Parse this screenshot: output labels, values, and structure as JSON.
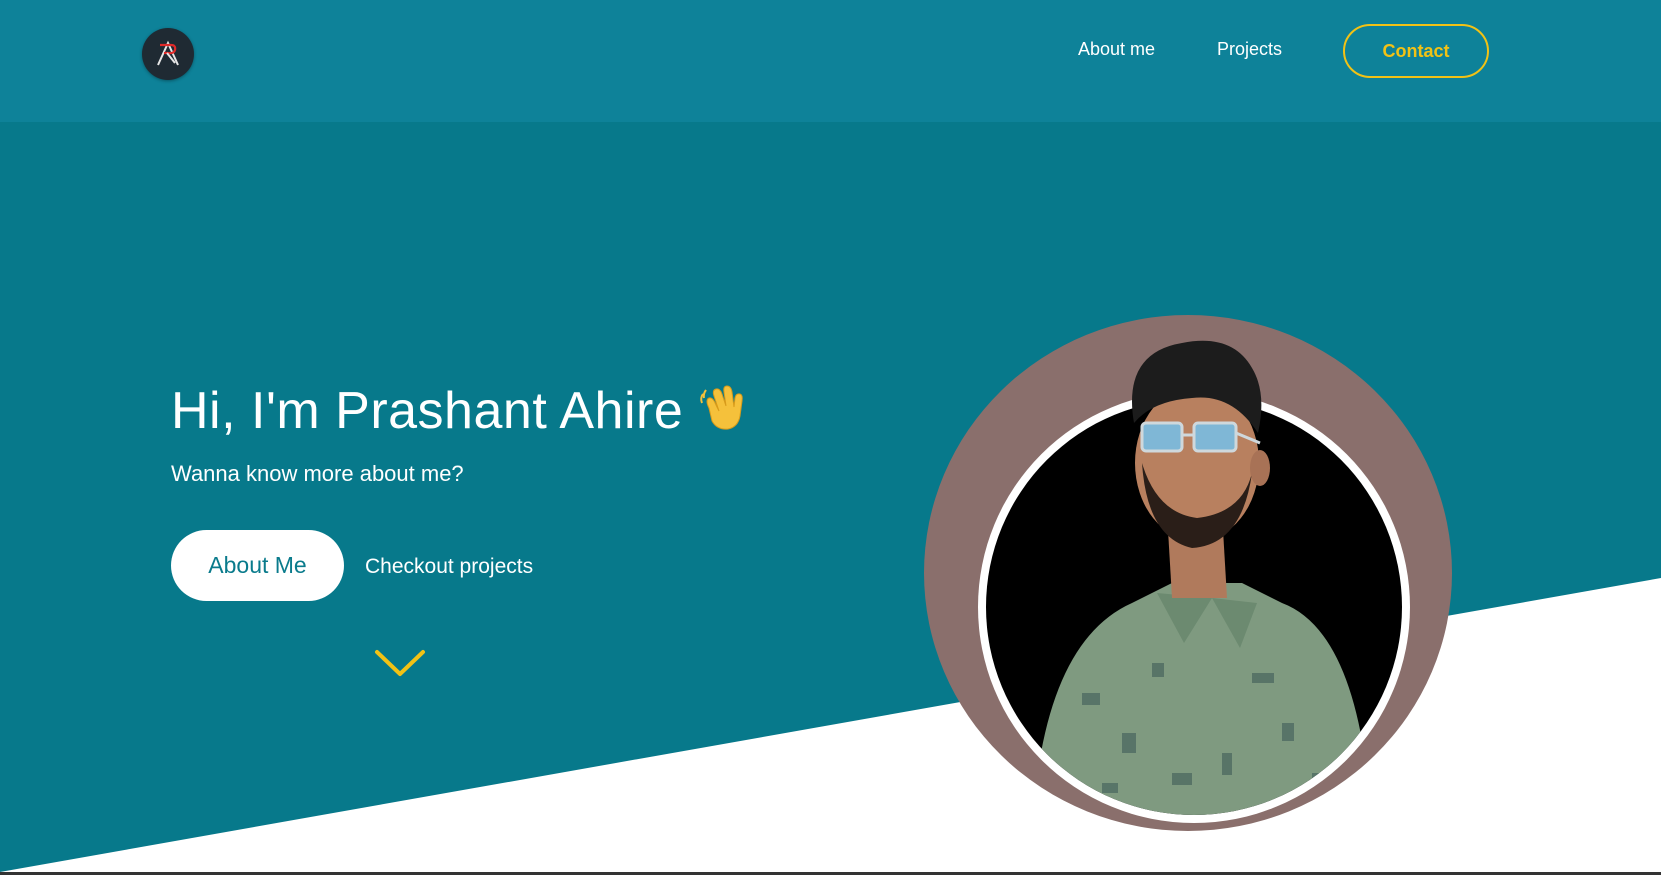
{
  "header": {
    "logo_letters": "PA",
    "nav": [
      {
        "label": "About me"
      },
      {
        "label": "Projects"
      }
    ],
    "contact_label": "Contact"
  },
  "hero": {
    "title": "Hi, I'm Prashant Ahire",
    "subtitle": "Wanna know more about me?",
    "primary_button": "About Me",
    "secondary_link": "Checkout projects",
    "wave_icon": "waving-hand-icon",
    "scroll_icon": "chevron-down-icon"
  },
  "colors": {
    "header_bg": "#0e8299",
    "hero_bg": "#07798b",
    "accent_yellow": "#f2c215",
    "profile_ring": "#8a6f6c",
    "logo_bg": "#1f2a33",
    "logo_red": "#e02a2a"
  }
}
